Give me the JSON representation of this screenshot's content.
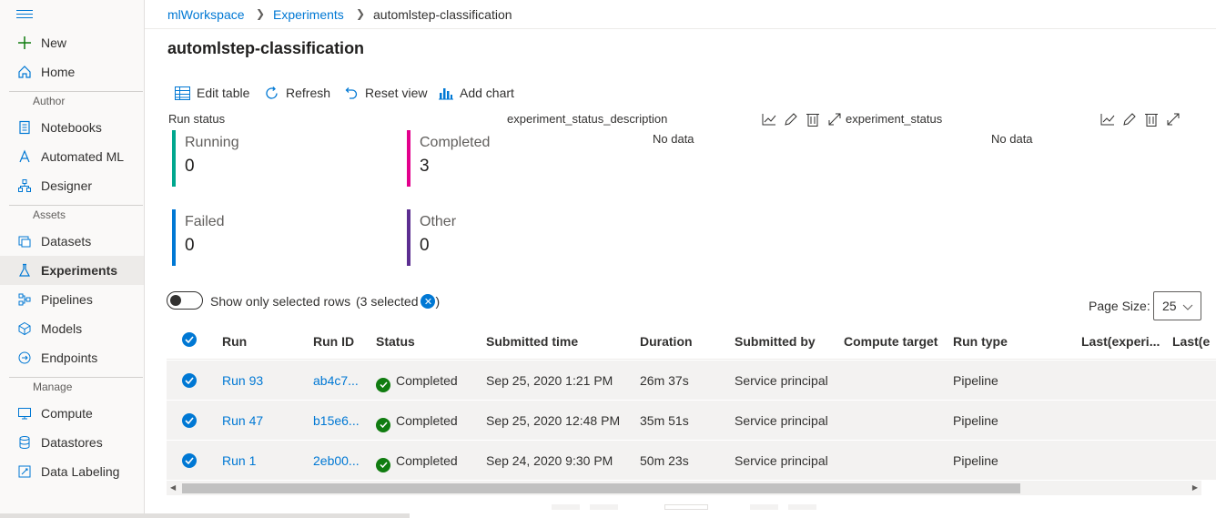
{
  "sidebar": {
    "items": [
      {
        "label": "New",
        "icon": "plus-icon"
      },
      {
        "label": "Home",
        "icon": "home-icon"
      },
      {
        "label": "Notebooks",
        "icon": "notebook-icon"
      },
      {
        "label": "Automated ML",
        "icon": "automl-icon"
      },
      {
        "label": "Designer",
        "icon": "designer-icon"
      },
      {
        "label": "Datasets",
        "icon": "datasets-icon"
      },
      {
        "label": "Experiments",
        "icon": "flask-icon"
      },
      {
        "label": "Pipelines",
        "icon": "pipelines-icon"
      },
      {
        "label": "Models",
        "icon": "models-icon"
      },
      {
        "label": "Endpoints",
        "icon": "endpoints-icon"
      },
      {
        "label": "Compute",
        "icon": "compute-icon"
      },
      {
        "label": "Datastores",
        "icon": "datastores-icon"
      },
      {
        "label": "Data Labeling",
        "icon": "labeling-icon"
      }
    ],
    "sections": {
      "author": "Author",
      "assets": "Assets",
      "manage": "Manage"
    },
    "active": "Experiments"
  },
  "breadcrumb": {
    "workspace": "mlWorkspace",
    "experiments": "Experiments",
    "current": "automlstep-classification"
  },
  "page_title": "automlstep-classification",
  "toolbar": {
    "edit_table": "Edit table",
    "refresh": "Refresh",
    "reset_view": "Reset view",
    "add_chart": "Add chart"
  },
  "run_status": {
    "title": "Run status",
    "running": {
      "label": "Running",
      "value": "0",
      "color": "#00a78e"
    },
    "completed": {
      "label": "Completed",
      "value": "3",
      "color": "#e3008c"
    },
    "failed": {
      "label": "Failed",
      "value": "0",
      "color": "#0078d4"
    },
    "other": {
      "label": "Other",
      "value": "0",
      "color": "#5c2e91"
    }
  },
  "charts": [
    {
      "title": "experiment_status_description",
      "empty": "No data"
    },
    {
      "title": "experiment_status",
      "empty": "No data"
    }
  ],
  "filter": {
    "toggle_label": "Show only selected rows",
    "selected": "(3 selected",
    "selected_close": ")"
  },
  "page_size": {
    "label": "Page Size:",
    "value": "25"
  },
  "table": {
    "headers": [
      "Run",
      "Run ID",
      "Status",
      "Submitted time",
      "Duration",
      "Submitted by",
      "Compute target",
      "Run type",
      "Last(experi...",
      "Last(e"
    ],
    "rows": [
      {
        "run": "Run 93",
        "run_id": "ab4c7...",
        "status": "Completed",
        "submitted": "Sep 25, 2020 1:21 PM",
        "duration": "26m 37s",
        "by": "Service principal",
        "compute": "",
        "type": "Pipeline"
      },
      {
        "run": "Run 47",
        "run_id": "b15e6...",
        "status": "Completed",
        "submitted": "Sep 25, 2020 12:48 PM",
        "duration": "35m 51s",
        "by": "Service principal",
        "compute": "",
        "type": "Pipeline"
      },
      {
        "run": "Run 1",
        "run_id": "2eb00...",
        "status": "Completed",
        "submitted": "Sep 24, 2020 9:30 PM",
        "duration": "50m 23s",
        "by": "Service principal",
        "compute": "",
        "type": "Pipeline"
      }
    ]
  }
}
